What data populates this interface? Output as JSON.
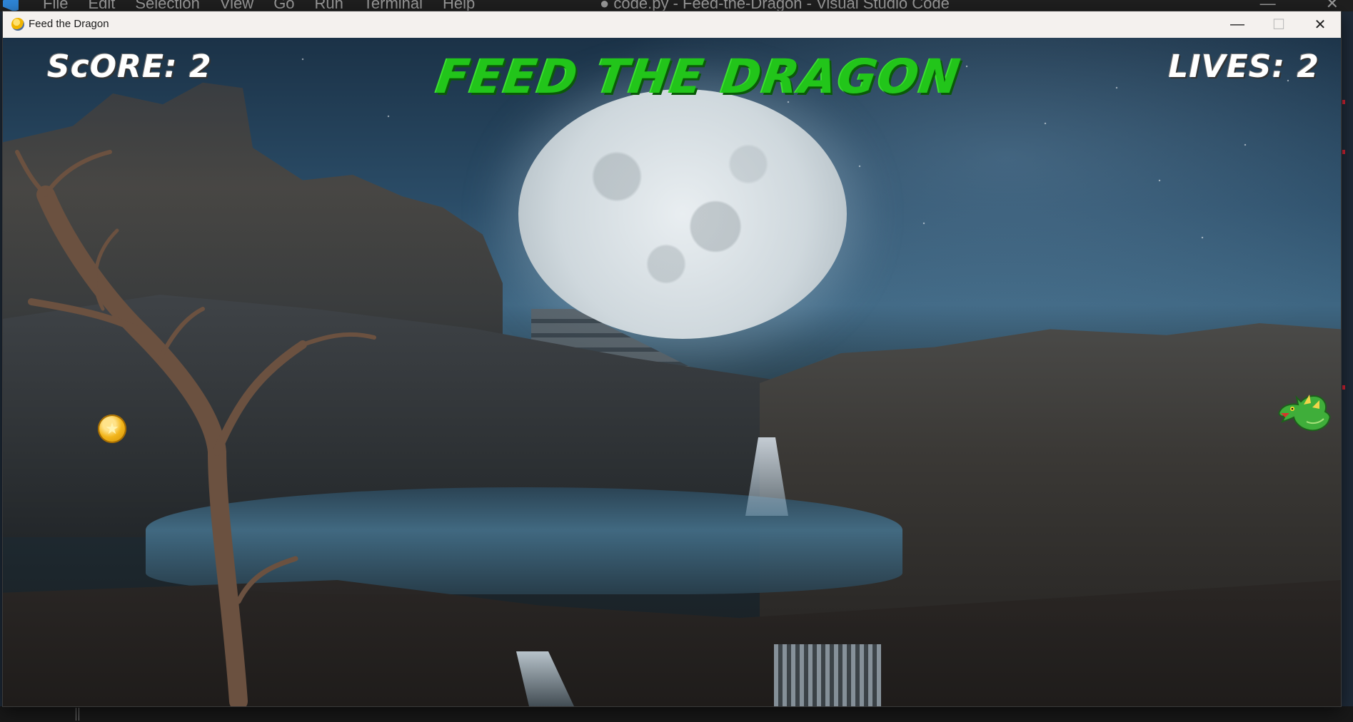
{
  "background_app": {
    "menu": [
      "File",
      "Edit",
      "Selection",
      "View",
      "Go",
      "Run",
      "Terminal",
      "Help"
    ],
    "title": "● code.py - Feed-the-Dragon - Visual Studio Code"
  },
  "window": {
    "title": "Feed the Dragon",
    "minimize_glyph": "—",
    "maximize_glyph": "☐",
    "close_glyph": "✕"
  },
  "hud": {
    "score_text": "ScORE: 2",
    "lives_text": "LIVES: 2",
    "game_title": "FEED THE DRAGON"
  },
  "game_state": {
    "score": 2,
    "lives": 2
  },
  "sprites": {
    "coin": {
      "icon": "coin-icon",
      "color": "#f2b51b"
    },
    "dragon": {
      "icon": "dragon-icon",
      "color": "#3fae3a"
    }
  },
  "colors": {
    "title_green": "#22c51a",
    "hud_white": "#ffffff"
  }
}
